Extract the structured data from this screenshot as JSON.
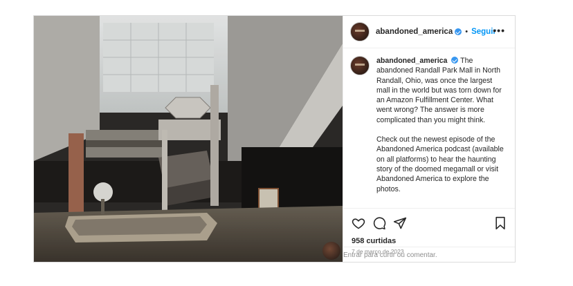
{
  "post": {
    "username": "abandoned_america",
    "follow_label": "Seguir",
    "more_label": "•••",
    "caption_p1": "The abandoned Randall Park Mall in North Randall, Ohio, was once the largest mall in the world but was torn down for an Amazon Fulfillment Center. What went wrong? The answer is more complicated than you might think.",
    "caption_p2": "Check out the newest episode of the Abandoned America podcast (available on all platforms) to hear the haunting story of the doomed megamall or visit Abandoned America to explore the photos.",
    "likes": "958 curtidas",
    "date": "7 de março de 2023",
    "comment_prompt": "Entrar para curtir ou comentar.",
    "colors": {
      "link": "#0095f6",
      "verified": "#3897f0"
    },
    "icons": [
      "heart-icon",
      "comment-icon",
      "share-icon",
      "bookmark-icon",
      "verified-icon"
    ]
  }
}
